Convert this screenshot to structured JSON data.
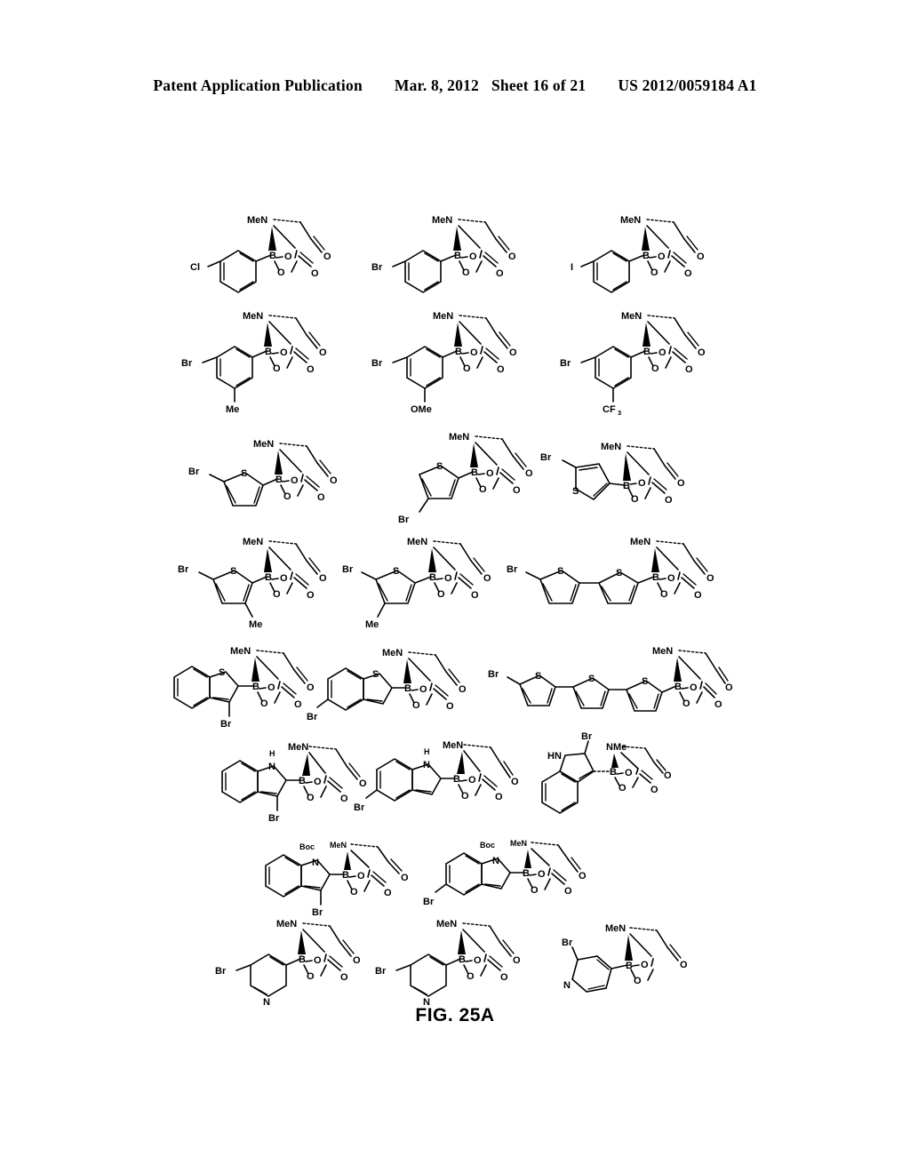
{
  "header": {
    "publication_label": "Patent Application Publication",
    "date": "Mar. 8, 2012",
    "sheet": "Sheet 16 of 21",
    "patent_number": "US 2012/0059184 A1"
  },
  "figure": {
    "caption": "FIG. 25A"
  },
  "labels": {
    "MeN": "MeN",
    "NMe": "NMe",
    "N": "N",
    "HN": "HN",
    "H": "H",
    "B": "B",
    "O": "O",
    "S": "S",
    "Br": "Br",
    "Cl": "Cl",
    "I": "I",
    "Me": "Me",
    "OMe": "OMe",
    "CF": "CF",
    "CF_sub": "3",
    "Boc": "Boc"
  },
  "structures": [
    {
      "id": "s01",
      "row": 1,
      "core": "phenyl",
      "name": "4-chlorophenyl-MIDA-boronate",
      "substituents": [
        "Cl"
      ],
      "boron_label": "B",
      "amine_label": "MeN"
    },
    {
      "id": "s02",
      "row": 1,
      "core": "phenyl",
      "name": "4-bromophenyl-MIDA-boronate",
      "substituents": [
        "Br"
      ],
      "boron_label": "B",
      "amine_label": "MeN"
    },
    {
      "id": "s03",
      "row": 1,
      "core": "phenyl",
      "name": "4-iodophenyl-MIDA-boronate",
      "substituents": [
        "I"
      ],
      "boron_label": "B",
      "amine_label": "MeN"
    },
    {
      "id": "s04",
      "row": 2,
      "core": "phenyl",
      "name": "3-bromo-5-methylphenyl-MIDA-boronate",
      "substituents": [
        "Br",
        "Me"
      ],
      "boron_label": "B",
      "amine_label": "MeN"
    },
    {
      "id": "s05",
      "row": 2,
      "core": "phenyl",
      "name": "3-bromo-5-methoxyphenyl-MIDA-boronate",
      "substituents": [
        "Br",
        "OMe"
      ],
      "boron_label": "B",
      "amine_label": "MeN"
    },
    {
      "id": "s06",
      "row": 2,
      "core": "phenyl",
      "name": "3-bromo-5-trifluoromethylphenyl-MIDA-boronate",
      "substituents": [
        "Br",
        "CF3"
      ],
      "boron_label": "B",
      "amine_label": "MeN"
    },
    {
      "id": "s07",
      "row": 3,
      "core": "thiophene",
      "name": "5-bromothiophen-2-yl-MIDA-boronate",
      "substituents": [
        "Br"
      ],
      "boron_label": "B",
      "amine_label": "MeN"
    },
    {
      "id": "s08",
      "row": 3,
      "core": "thiophene",
      "name": "4-bromothiophen-2-yl-MIDA-boronate",
      "substituents": [
        "Br"
      ],
      "boron_label": "B",
      "amine_label": "MeN"
    },
    {
      "id": "s09",
      "row": 3,
      "core": "thiophene",
      "name": "5-bromothiophen-3-yl-MIDA-boronate",
      "substituents": [
        "Br"
      ],
      "boron_label": "B",
      "amine_label": "MeN"
    },
    {
      "id": "s10",
      "row": 4,
      "core": "thiophene",
      "name": "5-bromo-4-methylthiophen-2-yl-MIDA-boronate",
      "substituents": [
        "Br",
        "Me"
      ],
      "boron_label": "B",
      "amine_label": "MeN"
    },
    {
      "id": "s11",
      "row": 4,
      "core": "thiophene",
      "name": "5-bromo-3-methylthiophen-2-yl-MIDA-boronate",
      "substituents": [
        "Br",
        "Me"
      ],
      "boron_label": "B",
      "amine_label": "MeN"
    },
    {
      "id": "s12",
      "row": 4,
      "core": "bithiophene",
      "name": "5'-bromo-2,2'-bithiophen-5-yl-MIDA-boronate",
      "substituents": [
        "Br"
      ],
      "boron_label": "B",
      "amine_label": "MeN"
    },
    {
      "id": "s13",
      "row": 5,
      "core": "benzothiophene",
      "name": "3-bromobenzothiophen-2-yl-MIDA-boronate",
      "substituents": [
        "Br"
      ],
      "boron_label": "B",
      "amine_label": "MeN"
    },
    {
      "id": "s14",
      "row": 5,
      "core": "benzothiophene",
      "name": "5-bromobenzothiophen-2-yl-MIDA-boronate",
      "substituents": [
        "Br"
      ],
      "boron_label": "B",
      "amine_label": "MeN"
    },
    {
      "id": "s15",
      "row": 5,
      "core": "terthiophene",
      "name": "5''-bromo-terthiophen-5-yl-MIDA-boronate",
      "substituents": [
        "Br"
      ],
      "boron_label": "B",
      "amine_label": "MeN"
    },
    {
      "id": "s16",
      "row": 6,
      "core": "indole",
      "name": "3-bromo-1H-indol-2-yl-MIDA-boronate",
      "substituents": [
        "Br",
        "H"
      ],
      "boron_label": "B",
      "amine_label": "MeN"
    },
    {
      "id": "s17",
      "row": 6,
      "core": "indole",
      "name": "5-bromo-1H-indol-2-yl-MIDA-boronate",
      "substituents": [
        "Br",
        "H"
      ],
      "boron_label": "B",
      "amine_label": "MeN"
    },
    {
      "id": "s18",
      "row": 6,
      "core": "indole",
      "name": "2-bromo-1H-indol-3-yl-MIDA-boronate",
      "substituents": [
        "Br",
        "HN"
      ],
      "boron_label": "B",
      "amine_label": "NMe"
    },
    {
      "id": "s19",
      "row": 7,
      "core": "indole-Boc",
      "name": "N-Boc-3-bromoindol-2-yl-MIDA-boronate",
      "substituents": [
        "Boc",
        "Br"
      ],
      "boron_label": "B",
      "amine_label": "MeN"
    },
    {
      "id": "s20",
      "row": 7,
      "core": "indole-Boc",
      "name": "N-Boc-5-bromoindol-2-yl-MIDA-boronate",
      "substituents": [
        "Boc",
        "Br"
      ],
      "boron_label": "B",
      "amine_label": "MeN"
    },
    {
      "id": "s21",
      "row": 8,
      "core": "pyridine",
      "name": "5-bromopyridin-3-yl-MIDA-boronate",
      "substituents": [
        "Br",
        "N"
      ],
      "boron_label": "B",
      "amine_label": "MeN"
    },
    {
      "id": "s22",
      "row": 8,
      "core": "pyridine",
      "name": "6-bromopyridin-3-yl-MIDA-boronate",
      "substituents": [
        "Br",
        "N"
      ],
      "boron_label": "B",
      "amine_label": "MeN"
    },
    {
      "id": "s23",
      "row": 8,
      "core": "pyridine",
      "name": "2-bromopyridin-4-yl-MIDA-boronate",
      "substituents": [
        "Br",
        "N"
      ],
      "boron_label": "B",
      "amine_label": "MeN"
    }
  ]
}
